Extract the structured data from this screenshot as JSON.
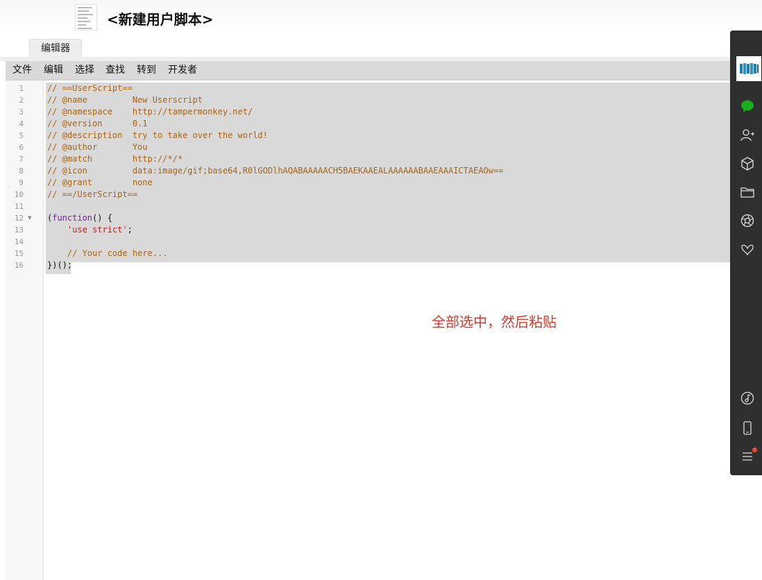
{
  "header": {
    "title": "<新建用户脚本>"
  },
  "tabs": [
    {
      "label": "编辑器"
    }
  ],
  "menu": [
    "文件",
    "编辑",
    "选择",
    "查找",
    "转到",
    "开发者"
  ],
  "editor": {
    "line_numbers": [
      "1",
      "2",
      "3",
      "4",
      "5",
      "6",
      "7",
      "8",
      "9",
      "10",
      "11",
      "12",
      "13",
      "14",
      "15",
      "16"
    ],
    "lines": [
      "// ==UserScript==",
      "// @name         New Userscript",
      "// @namespace    http://tampermonkey.net/",
      "// @version      0.1",
      "// @description  try to take over the world!",
      "// @author       You",
      "// @match        http://*/*",
      "// @icon         data:image/gif;base64,R0lGODlhAQABAAAAACH5BAEKAAEALAAAAAABAAEAAAICTAEAOw==",
      "// @grant        none",
      "// ==/UserScript==",
      "",
      {
        "kw": "function",
        "pre": "(",
        "post": "() {"
      },
      {
        "str": "'use strict'",
        "indent": "    ",
        "post": ";"
      },
      "",
      "    // Your code here...",
      "})();"
    ]
  },
  "annotation": "全部选中，然后粘贴",
  "sidebar": {
    "icons": [
      "book-logo-icon",
      "chat-icon",
      "user-add-icon",
      "cube-icon",
      "folder-icon",
      "aperture-icon",
      "butterfly-icon",
      "music-note-icon",
      "phone-icon",
      "menu-icon"
    ],
    "accent": "#1aad19"
  }
}
